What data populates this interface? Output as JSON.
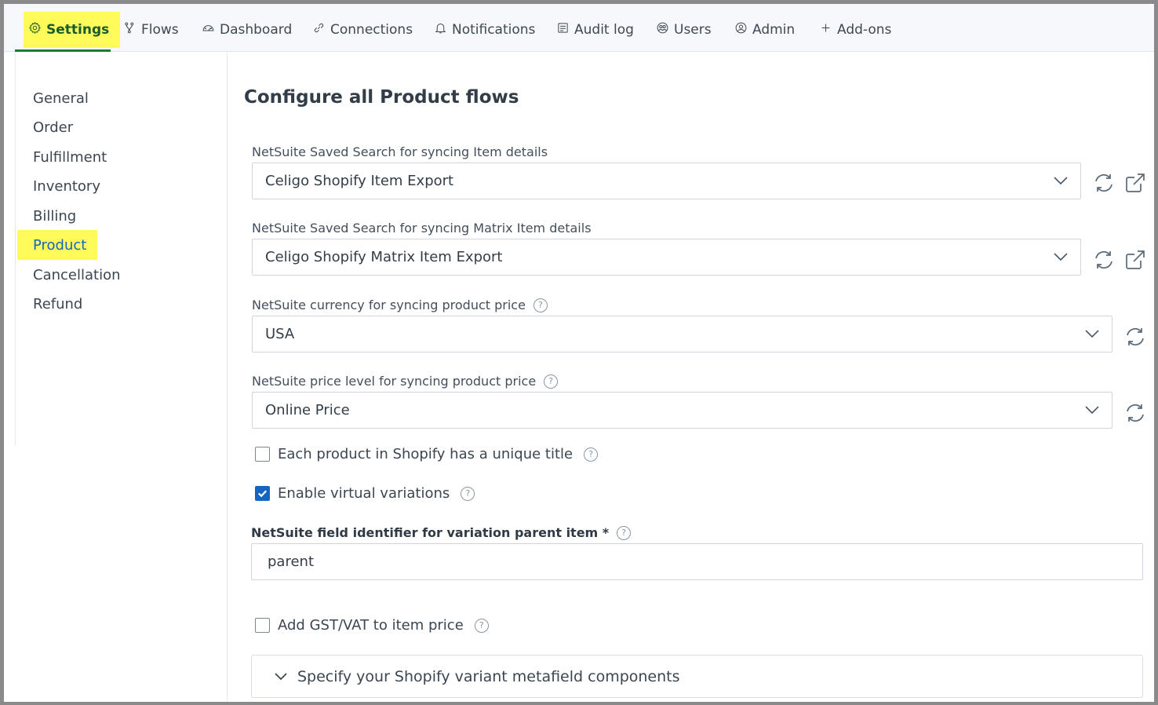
{
  "topnav": {
    "tabs": [
      {
        "label": "Settings",
        "icon": "gear-icon",
        "active": true
      },
      {
        "label": "Flows",
        "icon": "flow-icon"
      },
      {
        "label": "Dashboard",
        "icon": "dashboard-icon"
      },
      {
        "label": "Connections",
        "icon": "link-icon"
      },
      {
        "label": "Notifications",
        "icon": "bell-icon"
      },
      {
        "label": "Audit log",
        "icon": "audit-icon"
      },
      {
        "label": "Users",
        "icon": "users-icon"
      },
      {
        "label": "Admin",
        "icon": "admin-icon"
      },
      {
        "label": "Add-ons",
        "icon": "plus-icon"
      }
    ]
  },
  "sidebar": {
    "items": [
      {
        "label": "General"
      },
      {
        "label": "Order"
      },
      {
        "label": "Fulfillment"
      },
      {
        "label": "Inventory"
      },
      {
        "label": "Billing"
      },
      {
        "label": "Product",
        "active": true
      },
      {
        "label": "Cancellation"
      },
      {
        "label": "Refund"
      }
    ]
  },
  "main": {
    "title": "Configure all Product flows",
    "item_search": {
      "label": "NetSuite Saved Search for syncing Item details",
      "value": "Celigo Shopify Item Export"
    },
    "matrix_search": {
      "label": "NetSuite Saved Search for syncing Matrix Item details",
      "value": "Celigo Shopify Matrix Item Export"
    },
    "currency": {
      "label": "NetSuite currency for syncing product price",
      "value": "USA"
    },
    "price_level": {
      "label": "NetSuite price level for syncing product price",
      "value": "Online Price"
    },
    "unique_title": {
      "label": "Each product in Shopify has a unique title",
      "checked": false
    },
    "virtual_variations": {
      "label": "Enable virtual variations",
      "checked": true
    },
    "parent_field": {
      "label": "NetSuite field identifier for variation parent item *",
      "value": "parent"
    },
    "gst_vat": {
      "label": "Add GST/VAT to item price",
      "checked": false
    },
    "metafield_section": {
      "label": "Specify your Shopify variant metafield components"
    },
    "help_glyph": "?"
  },
  "colors": {
    "highlight": "#fffb5a",
    "accent_blue": "#1565c0",
    "active_tab_text": "#1a5c2a"
  }
}
